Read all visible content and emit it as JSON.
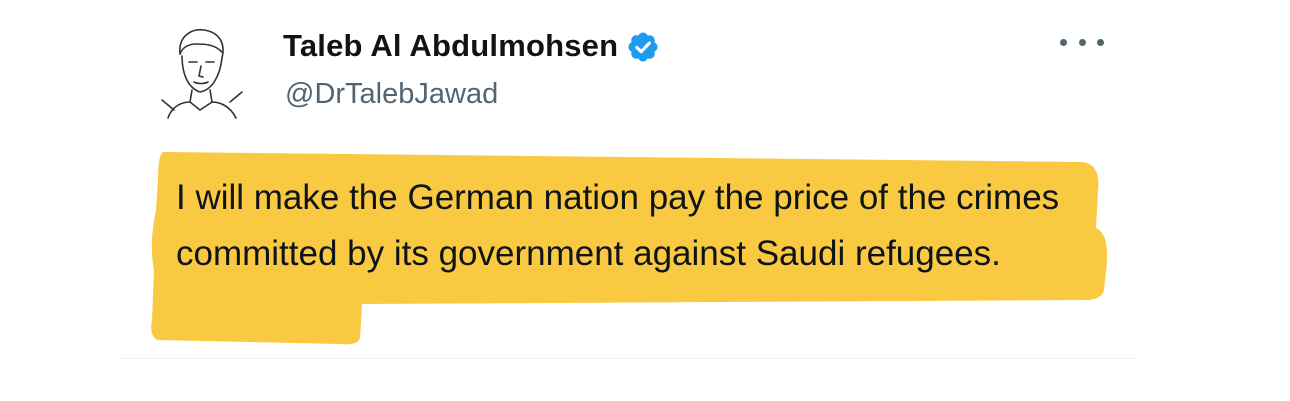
{
  "author": {
    "display_name": "Taleb Al Abdulmohsen",
    "handle": "@DrTalebJawad",
    "verified": true,
    "verified_color": "#1d9bf0",
    "avatar_icon": "sketch-portrait-avatar"
  },
  "menu": {
    "icon": "more-horizontal-icon"
  },
  "tweet": {
    "text": "I will make the German nation pay the price of the crimes committed by its government against Saudi refugees.",
    "highlight_color": "#f8c431"
  }
}
